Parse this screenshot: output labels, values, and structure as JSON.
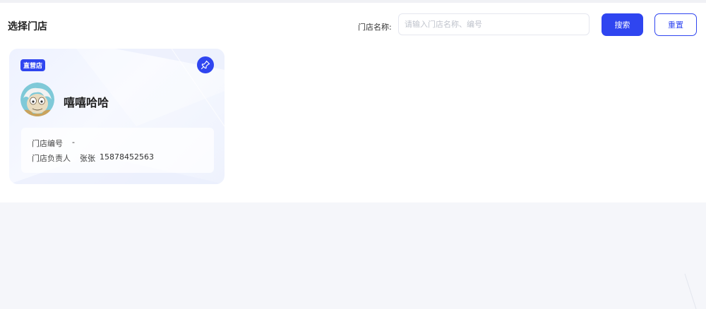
{
  "header": {
    "title": "选择门店",
    "search_label": "门店名称:",
    "search_placeholder": "请输入门店名称、编号",
    "search_value": "",
    "search_button": "搜索",
    "reset_button": "重置"
  },
  "stores": [
    {
      "badge": "直营店",
      "name": "嘻嘻哈哈",
      "pin_icon": "pin-icon",
      "fields": [
        {
          "label": "门店编号",
          "value": "-"
        },
        {
          "label": "门店负责人",
          "value": "张张",
          "phone": "15878452563"
        }
      ]
    }
  ],
  "colors": {
    "primary": "#2f45f0",
    "page_bg": "#f5f6fa",
    "panel_bg": "#ffffff"
  }
}
